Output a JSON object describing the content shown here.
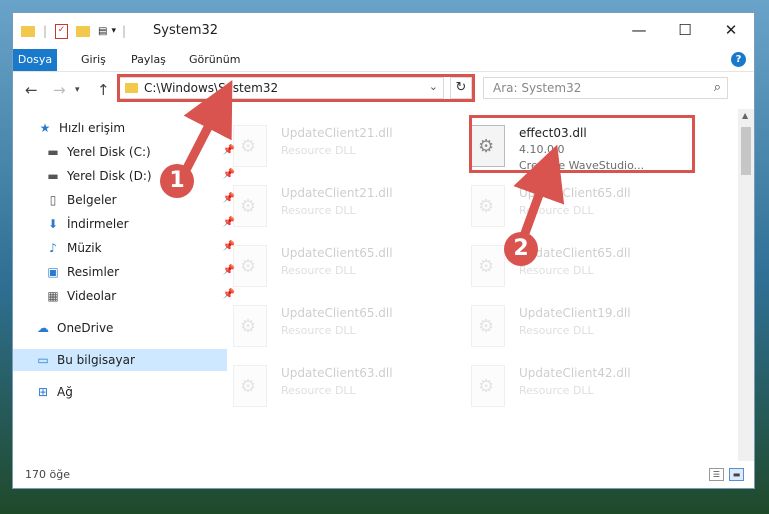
{
  "window": {
    "title": "System32",
    "controls": {
      "minimize": "—",
      "maximize": "☐",
      "close": "✕"
    }
  },
  "ribbon": {
    "tabs": [
      "Dosya",
      "Giriş",
      "Paylaş",
      "Görünüm"
    ],
    "help": "?"
  },
  "address": {
    "path": "C:\\Windows\\System32",
    "search_placeholder": "Ara: System32"
  },
  "sidebar": {
    "items": [
      {
        "label": "Hızlı erişim",
        "icon": "star-icon"
      },
      {
        "label": "Yerel Disk (C:)",
        "icon": "drive-icon"
      },
      {
        "label": "Yerel Disk (D:)",
        "icon": "drive-icon"
      },
      {
        "label": "Belgeler",
        "icon": "document-icon"
      },
      {
        "label": "İndirmeler",
        "icon": "download-icon"
      },
      {
        "label": "Müzik",
        "icon": "music-icon"
      },
      {
        "label": "Resimler",
        "icon": "picture-icon"
      },
      {
        "label": "Videolar",
        "icon": "video-icon"
      },
      {
        "label": "OneDrive",
        "icon": "cloud-icon"
      },
      {
        "label": "Bu bilgisayar",
        "icon": "computer-icon"
      },
      {
        "label": "Ağ",
        "icon": "network-icon"
      }
    ]
  },
  "files": [
    {
      "name": "UpdateClient21.dll",
      "sub": "Resource DLL"
    },
    {
      "name": "effect03.dll",
      "version": "4.10.0.0",
      "company": "Creative WaveStudio..."
    },
    {
      "name": "UpdateClient21.dll",
      "sub": "Resource DLL"
    },
    {
      "name": "UpdateClient65.dll",
      "sub": "Resource DLL"
    },
    {
      "name": "UpdateClient65.dll",
      "sub": "Resource DLL"
    },
    {
      "name": "UpdateClient65.dll",
      "sub": "Resource DLL"
    },
    {
      "name": "UpdateClient65.dll",
      "sub": "Resource DLL"
    },
    {
      "name": "UpdateClient19.dll",
      "sub": "Resource DLL"
    },
    {
      "name": "UpdateClient63.dll",
      "sub": "Resource DLL"
    },
    {
      "name": "UpdateClient42.dll",
      "sub": "Resource DLL"
    }
  ],
  "status": {
    "count": "170 öğe"
  },
  "callouts": [
    "1",
    "2"
  ],
  "colors": {
    "accent": "#1979ca",
    "highlight": "#d9534f",
    "selected": "#cde8ff"
  }
}
